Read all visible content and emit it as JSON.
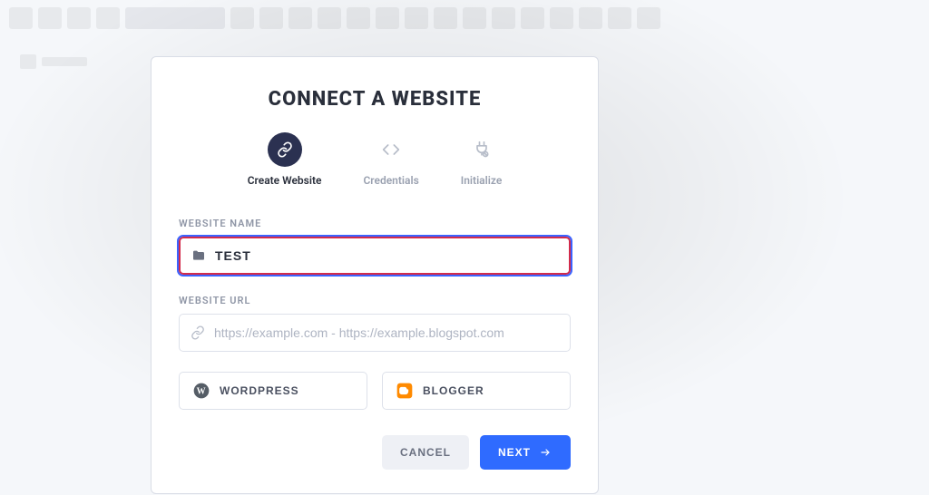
{
  "modal": {
    "title": "CONNECT A WEBSITE",
    "steps": [
      {
        "label": "Create Website",
        "icon": "link-icon",
        "active": true
      },
      {
        "label": "Credentials",
        "icon": "code-icon",
        "active": false
      },
      {
        "label": "Initialize",
        "icon": "plug-icon",
        "active": false
      }
    ],
    "fields": {
      "name": {
        "label": "WEBSITE NAME",
        "value": "TEST"
      },
      "url": {
        "label": "WEBSITE URL",
        "placeholder": "https://example.com - https://example.blogspot.com"
      }
    },
    "platforms": {
      "wordpress": "WORDPRESS",
      "blogger": "BLOGGER"
    },
    "buttons": {
      "cancel": "CANCEL",
      "next": "NEXT"
    }
  }
}
